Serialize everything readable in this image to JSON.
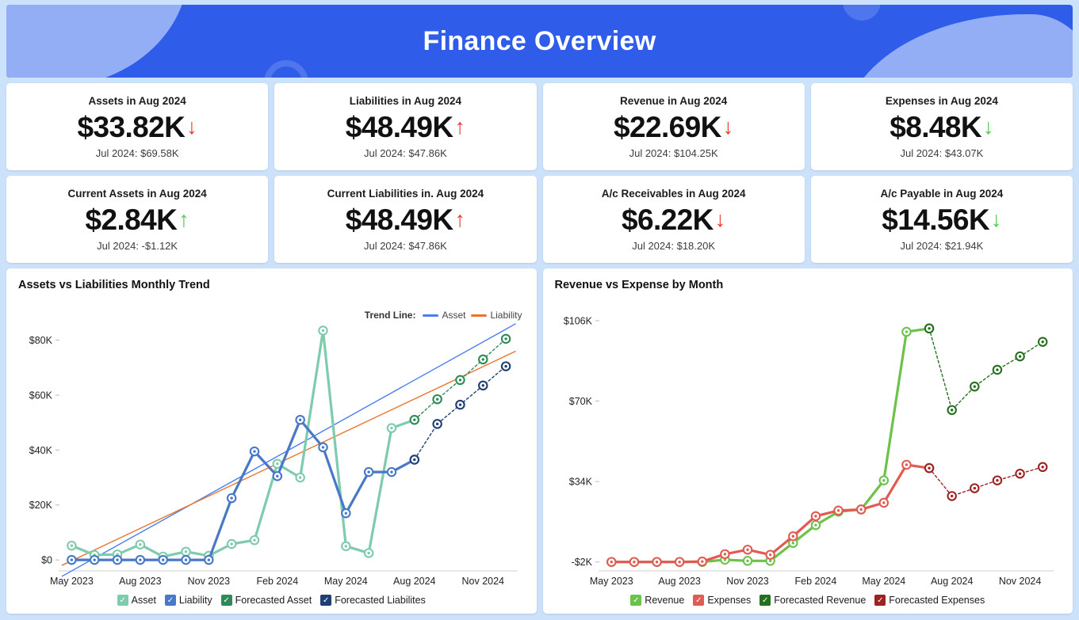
{
  "header": {
    "title": "Finance Overview",
    "bg_color": "#2f5ce8",
    "accent_blob_color": "#94aef6"
  },
  "kpi_cards": [
    {
      "title": "Assets in Aug 2024",
      "value": "$33.82K",
      "arrow": "↓",
      "arrow_color": "#e8392b",
      "sub": "Jul 2024: $69.58K"
    },
    {
      "title": "Liabilities in Aug 2024",
      "value": "$48.49K",
      "arrow": "↑",
      "arrow_color": "#e8392b",
      "sub": "Jul 2024: $47.86K"
    },
    {
      "title": "Revenue in Aug 2024",
      "value": "$22.69K",
      "arrow": "↓",
      "arrow_color": "#e8392b",
      "sub": "Jul 2024: $104.25K"
    },
    {
      "title": "Expenses in Aug 2024",
      "value": "$8.48K",
      "arrow": "↓",
      "arrow_color": "#4ec84e",
      "sub": "Jul 2024: $43.07K"
    },
    {
      "title": "Current Assets in Aug 2024",
      "value": "$2.84K",
      "arrow": "↑",
      "arrow_color": "#4ec84e",
      "sub": "Jul 2024: -$1.12K"
    },
    {
      "title": "Current Liabilities in. Aug 2024",
      "value": "$48.49K",
      "arrow": "↑",
      "arrow_color": "#e8392b",
      "sub": "Jul 2024: $47.86K"
    },
    {
      "title": "A/c Receivables in Aug 2024",
      "value": "$6.22K",
      "arrow": "↓",
      "arrow_color": "#e8392b",
      "sub": "Jul 2024: $18.20K"
    },
    {
      "title": "A/c Payable in Aug 2024",
      "value": "$14.56K",
      "arrow": "↓",
      "arrow_color": "#4ec84e",
      "sub": "Jul 2024: $21.94K"
    }
  ],
  "chart_data": [
    {
      "type": "line",
      "title": "Assets vs Liabilities Monthly Trend",
      "xlabel": "",
      "ylabel": "",
      "ylim": [
        -4000,
        92000
      ],
      "yticks": [
        0,
        20000,
        40000,
        60000,
        80000
      ],
      "ytick_labels": [
        "$0",
        "$20K",
        "$40K",
        "$60K",
        "$80K"
      ],
      "grid": false,
      "legend_position": "bottom",
      "x": [
        "May 2023",
        "Jun 2023",
        "Jul 2023",
        "Aug 2023",
        "Sep 2023",
        "Oct 2023",
        "Nov 2023",
        "Dec 2023",
        "Jan 2024",
        "Feb 2024",
        "Mar 2024",
        "Apr 2024",
        "May 2024",
        "Jun 2024",
        "Jul 2024",
        "Aug 2024",
        "Sep 2024",
        "Oct 2024",
        "Nov 2024",
        "Dec 2024"
      ],
      "xtick_labels": [
        "May 2023",
        "Aug 2023",
        "Nov 2023",
        "Feb 2024",
        "May 2024",
        "Aug 2024",
        "Nov 2024"
      ],
      "xtick_indices": [
        0,
        3,
        6,
        9,
        12,
        15,
        18
      ],
      "series": [
        {
          "name": "Asset",
          "color": "#7ecbae",
          "style": "solid",
          "values": [
            5200,
            1800,
            2000,
            5600,
            1200,
            3000,
            1500,
            5800,
            7200,
            35000,
            30000,
            83500,
            5000,
            2500,
            48000,
            51000,
            null,
            null,
            null,
            null
          ]
        },
        {
          "name": "Liability",
          "color": "#4878c8",
          "style": "solid",
          "values": [
            0,
            0,
            0,
            0,
            0,
            0,
            0,
            22500,
            39500,
            30500,
            51000,
            41000,
            17000,
            32000,
            32000,
            36500,
            null,
            null,
            null,
            null
          ]
        },
        {
          "name": "Forecasted Asset",
          "color": "#2e8b57",
          "style": "dotted",
          "values": [
            null,
            null,
            null,
            null,
            null,
            null,
            null,
            null,
            null,
            null,
            null,
            null,
            null,
            null,
            null,
            51000,
            58500,
            65500,
            73000,
            80500
          ]
        },
        {
          "name": "Forecasted Liabilites",
          "color": "#1f3f73",
          "style": "dotted",
          "values": [
            null,
            null,
            null,
            null,
            null,
            null,
            null,
            null,
            null,
            null,
            null,
            null,
            null,
            null,
            null,
            36500,
            49500,
            56500,
            63500,
            70500
          ]
        }
      ],
      "trend_lines": [
        {
          "name": "Asset",
          "color": "#4a7ef0",
          "start_value": -6000,
          "end_value": 86000
        },
        {
          "name": "Liability",
          "color": "#e8742c",
          "start_value": -2000,
          "end_value": 76000
        }
      ],
      "trend_legend_label": "Trend Line:"
    },
    {
      "type": "line",
      "title": "Revenue vs Expense by Month",
      "xlabel": "",
      "ylabel": "",
      "ylim": [
        -6000,
        112000
      ],
      "yticks": [
        -2000,
        34000,
        70000,
        106000
      ],
      "ytick_labels": [
        "-$2K",
        "$34K",
        "$70K",
        "$106K"
      ],
      "grid": false,
      "legend_position": "bottom",
      "x": [
        "May 2023",
        "Jun 2023",
        "Jul 2023",
        "Aug 2023",
        "Sep 2023",
        "Oct 2023",
        "Nov 2023",
        "Dec 2023",
        "Jan 2024",
        "Feb 2024",
        "Mar 2024",
        "Apr 2024",
        "May 2024",
        "Jun 2024",
        "Jul 2024",
        "Aug 2024",
        "Sep 2024",
        "Oct 2024",
        "Nov 2024",
        "Dec 2024"
      ],
      "xtick_labels": [
        "May 2023",
        "Aug 2023",
        "Nov 2023",
        "Feb 2024",
        "May 2024",
        "Aug 2024",
        "Nov 2024"
      ],
      "xtick_indices": [
        0,
        3,
        6,
        9,
        12,
        15,
        18
      ],
      "series": [
        {
          "name": "Revenue",
          "color": "#6cc24a",
          "style": "solid",
          "values": [
            -2000,
            -2000,
            -2000,
            -2000,
            -2000,
            -1000,
            -1500,
            -1500,
            6500,
            14500,
            20500,
            21500,
            34500,
            101000,
            102500,
            null,
            null,
            null,
            null,
            null
          ]
        },
        {
          "name": "Expenses",
          "color": "#e05c52",
          "style": "solid",
          "values": [
            -2000,
            -2000,
            -2000,
            -2000,
            -1800,
            1500,
            3500,
            1200,
            9500,
            18500,
            21000,
            21500,
            24500,
            41500,
            40000,
            null,
            null,
            null,
            null,
            null
          ]
        },
        {
          "name": "Forecasted Revenue",
          "color": "#25701f",
          "style": "dotted",
          "values": [
            null,
            null,
            null,
            null,
            null,
            null,
            null,
            null,
            null,
            null,
            null,
            null,
            null,
            null,
            102500,
            66000,
            76500,
            84000,
            90000,
            96500
          ]
        },
        {
          "name": "Forecasted Expenses",
          "color": "#9b2323",
          "style": "dotted",
          "values": [
            null,
            null,
            null,
            null,
            null,
            null,
            null,
            null,
            null,
            null,
            null,
            null,
            null,
            null,
            40000,
            27500,
            31000,
            34500,
            37500,
            40500
          ]
        }
      ],
      "trend_lines": [],
      "trend_legend_label": ""
    }
  ]
}
